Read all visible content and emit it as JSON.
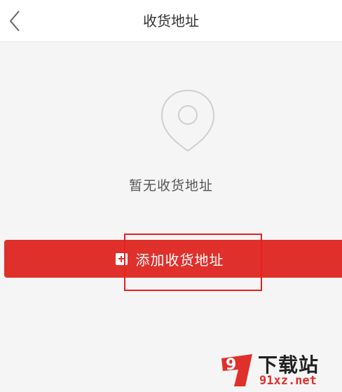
{
  "header": {
    "title": "收货地址",
    "back_icon": "chevron-left-icon"
  },
  "empty_state": {
    "icon": "location-pin-icon",
    "message": "暂无收货地址"
  },
  "add_button": {
    "icon": "plus-square-icon",
    "label": "添加收货地址"
  },
  "watermark": {
    "logo_text": "9",
    "title": "下载站",
    "domain": "91xz.net"
  },
  "colors": {
    "accent": "#e0302b",
    "highlight": "#e8201f",
    "background": "#f5f5f5",
    "icon_gray": "#cfcfcf"
  }
}
